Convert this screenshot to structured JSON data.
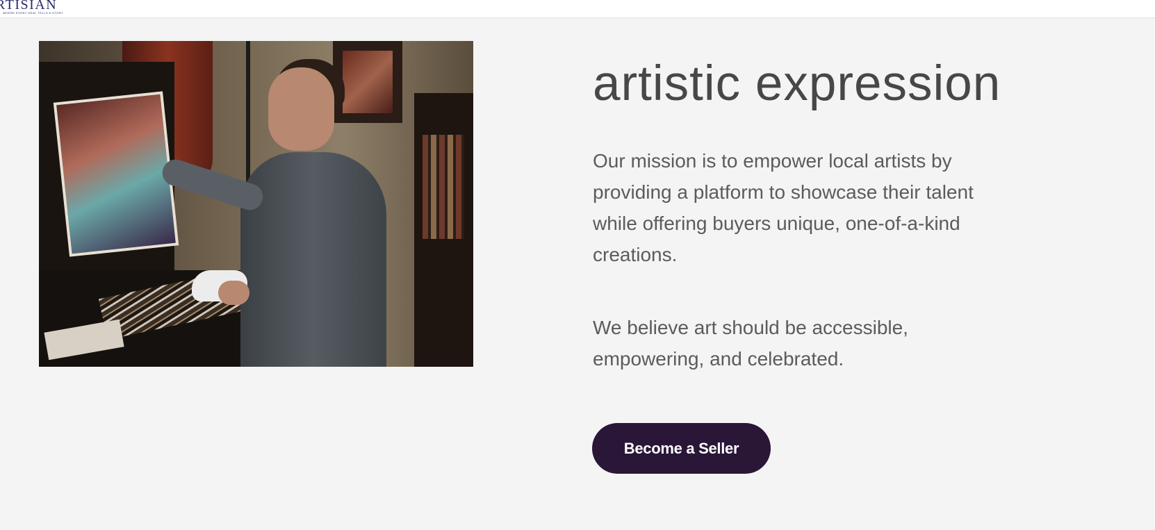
{
  "header": {
    "logo_text": "RTISIAN",
    "logo_tagline": "WHERE EVERY DEAL TELLS A STORY"
  },
  "hero": {
    "heading_partial": "artistic expression",
    "paragraph_1": "Our mission is to empower local artists by providing a platform to showcase their talent while offering buyers unique, one-of-a-kind creations.",
    "paragraph_2": "We believe art should be accessible, empowering, and celebrated.",
    "cta_label": "Become a Seller"
  },
  "colors": {
    "background": "#f4f4f4",
    "cta_background": "#2a1637",
    "heading_text": "#474747",
    "body_text": "#5b5b5b",
    "logo": "#2a2a6e"
  }
}
